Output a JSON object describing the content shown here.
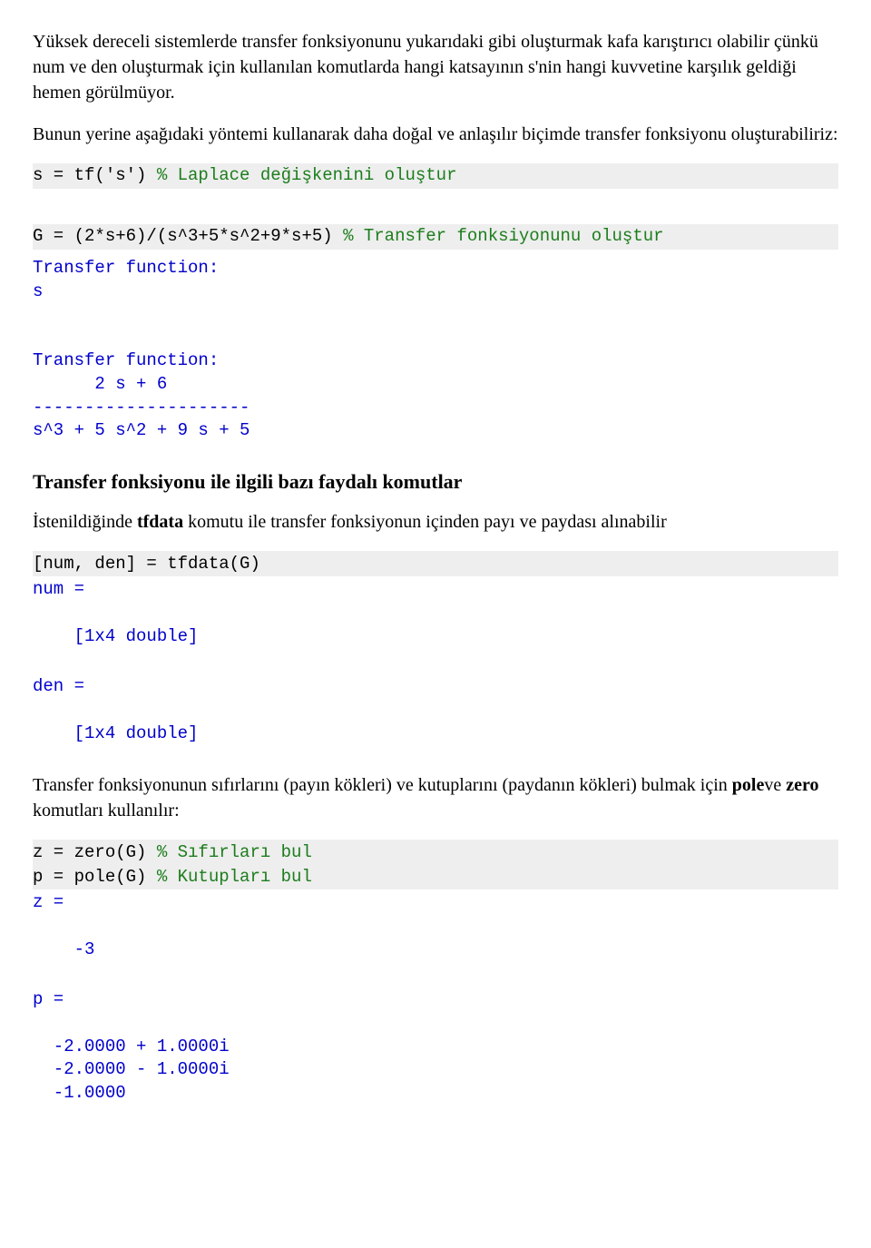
{
  "para1": "Yüksek dereceli sistemlerde transfer fonksiyonunu yukarıdaki gibi oluşturmak kafa karıştırıcı olabilir çünkü num ve den oluşturmak için kullanılan komutlarda hangi katsayının s'nin hangi kuvvetine karşılık geldiği hemen görülmüyor.",
  "para2": "Bunun yerine aşağıdaki yöntemi kullanarak daha doğal ve anlaşılır biçimde transfer fonksiyonu oluşturabiliriz:",
  "code1": {
    "line1_cmd": "s = tf('s') ",
    "line1_cmt": "% Laplace değişkenini oluştur",
    "line2_cmd": "G = (2*s+6)/(s^3+5*s^2+9*s+5) ",
    "line2_cmt": "% Transfer fonksiyonunu oluştur"
  },
  "out1": "Transfer function:\ns\n \n\nTransfer function:\n      2 s + 6\n---------------------\ns^3 + 5 s^2 + 9 s + 5",
  "heading": "Transfer fonksiyonu ile ilgili bazı faydalı komutlar",
  "para3_pre": "İstenildiğinde ",
  "para3_bold": "tfdata",
  "para3_post": " komutu ile transfer fonksiyonun içinden payı ve paydası alınabilir",
  "code2_gray": "[num, den] = tfdata(G)",
  "out2a": "num = \n\n    [1x4 double]",
  "out2b": "den = \n\n    [1x4 double]",
  "para4_pre": "Transfer fonksiyonunun sıfırlarını (payın kökleri) ve kutuplarını (paydanın kökleri) bulmak için ",
  "para4_b1": "pole",
  "para4_mid": "ve ",
  "para4_b2": "zero",
  "para4_post": " komutları kullanılır:",
  "code3": {
    "l1_cmd": "z = zero(G) ",
    "l1_cmt": "% Sıfırları bul",
    "l2_cmd": "p = pole(G) ",
    "l2_cmt": "% Kutupları bul"
  },
  "out3a": "z =\n\n    -3",
  "out3b": "p =\n\n  -2.0000 + 1.0000i\n  -2.0000 - 1.0000i\n  -1.0000"
}
